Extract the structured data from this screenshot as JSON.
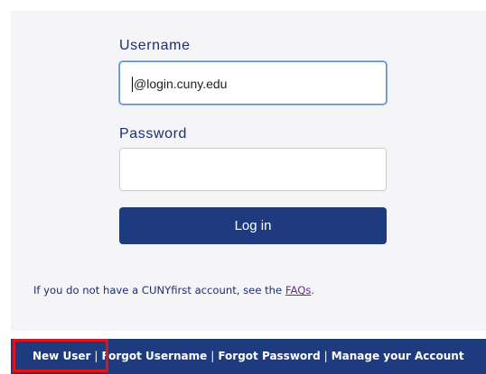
{
  "form": {
    "username_label": "Username",
    "username_value": "@login.cuny.edu",
    "password_label": "Password",
    "password_value": "",
    "login_button": "Log in"
  },
  "note": {
    "text": "If you do not have a CUNYfirst account, see the",
    "link": "FAQs",
    "end": "."
  },
  "footer": {
    "links": [
      "New User",
      "Forgot Username",
      "Forgot Password",
      "Manage your Account"
    ],
    "separator": "|"
  },
  "colors": {
    "brand_navy": "#1d3b7e",
    "highlight_red": "#e4111b",
    "link_purple": "#6a2a8c"
  }
}
